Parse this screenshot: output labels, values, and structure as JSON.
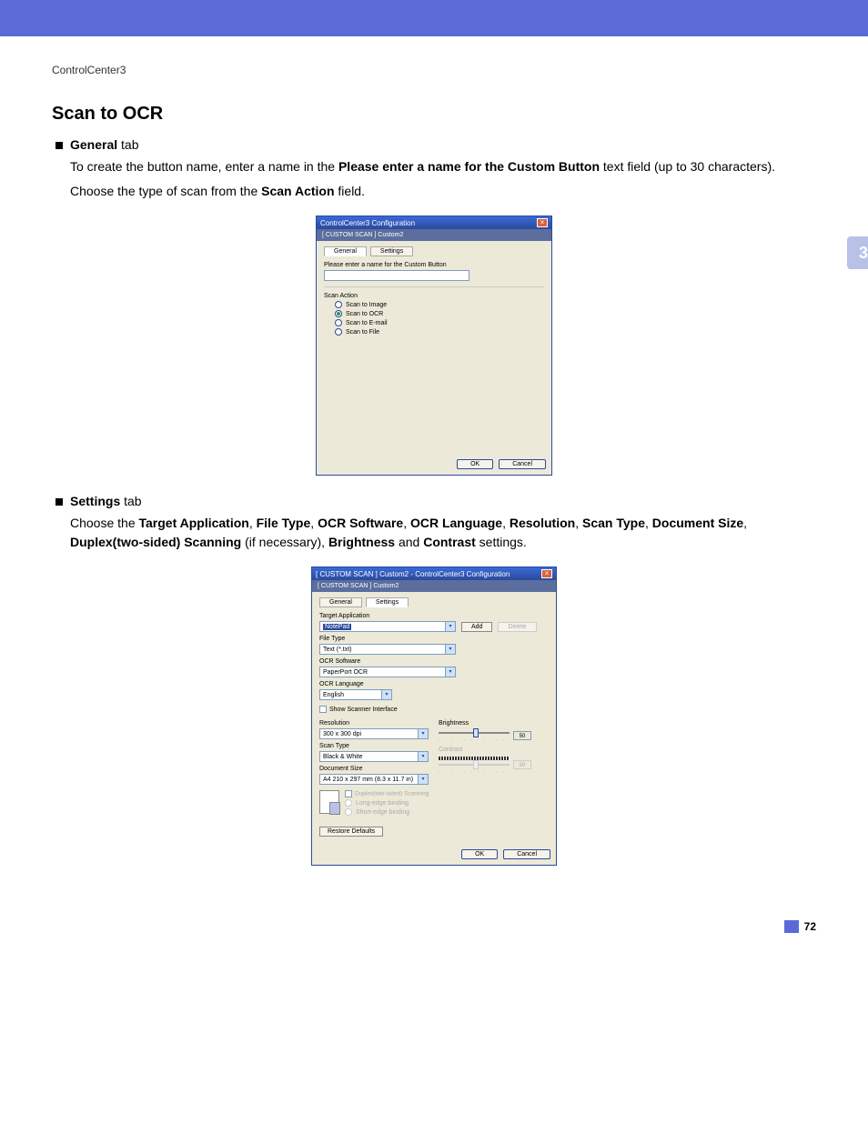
{
  "page": {
    "running_head": "ControlCenter3",
    "chapter_number": "3",
    "page_number": "72",
    "section_title": "Scan to OCR"
  },
  "body": {
    "bullet1_label_bold": "General",
    "bullet1_label_rest": " tab",
    "p1_a": "To create the button name, enter a name in the ",
    "p1_b": "Please enter a name for the Custom Button",
    "p1_c": " text field (up to 30 characters).",
    "p2_a": "Choose the type of scan from the ",
    "p2_b": "Scan Action",
    "p2_c": " field.",
    "bullet2_label_bold": "Settings",
    "bullet2_label_rest": " tab",
    "p3_a": "Choose the ",
    "p3_b": "Target Application",
    "p3_c": ", ",
    "p3_d": "File Type",
    "p3_e": ", ",
    "p3_f": "OCR Software",
    "p3_g": ", ",
    "p3_h": "OCR Language",
    "p3_i": ", ",
    "p3_j": "Resolution",
    "p3_k": ", ",
    "p3_l": "Scan Type",
    "p3_m": ", ",
    "p3_n": "Document Size",
    "p3_o": ", ",
    "p3_p": "Duplex(two-sided) Scanning",
    "p3_q": " (if necessary), ",
    "p3_r": "Brightness",
    "p3_s": " and ",
    "p3_t": "Contrast",
    "p3_u": " settings."
  },
  "dialog1": {
    "title": "ControlCenter3 Configuration",
    "subtitle": "[  CUSTOM SCAN  ]   Custom2",
    "tab_general": "General",
    "tab_settings": "Settings",
    "label_name": "Please enter a name for the Custom Button",
    "group_scan_action": "Scan Action",
    "opt_image": "Scan to Image",
    "opt_ocr": "Scan to OCR",
    "opt_email": "Scan to E-mail",
    "opt_file": "Scan to File",
    "btn_ok": "OK",
    "btn_cancel": "Cancel"
  },
  "dialog2": {
    "title": "[  CUSTOM SCAN  ]   Custom2 - ControlCenter3 Configuration",
    "subtitle": "[  CUSTOM SCAN  ]   Custom2",
    "tab_general": "General",
    "tab_settings": "Settings",
    "lbl_target": "Target Application",
    "val_target": "NotePad",
    "btn_add": "Add",
    "btn_delete": "Delete",
    "lbl_filetype": "File Type",
    "val_filetype": "Text (*.txt)",
    "lbl_ocrsoft": "OCR Software",
    "val_ocrsoft": "PaperPort OCR",
    "lbl_ocrlang": "OCR Language",
    "val_ocrlang": "English",
    "chk_scanner": "Show Scanner Interface",
    "lbl_resolution": "Resolution",
    "val_resolution": "300 x 300 dpi",
    "lbl_scantype": "Scan Type",
    "val_scantype": "Black & White",
    "lbl_docsize": "Document Size",
    "val_docsize": "A4 210 x 297 mm (8.3 x 11.7 in)",
    "lbl_brightness": "Brightness",
    "val_brightness": "50",
    "lbl_contrast": "Contrast",
    "val_contrast": "50",
    "chk_duplex": "Duplex(two-sided) Scanning",
    "opt_long": "Long-edge binding",
    "opt_short": "Short-edge binding",
    "btn_restore": "Restore Defaults",
    "btn_ok": "OK",
    "btn_cancel": "Cancel"
  }
}
